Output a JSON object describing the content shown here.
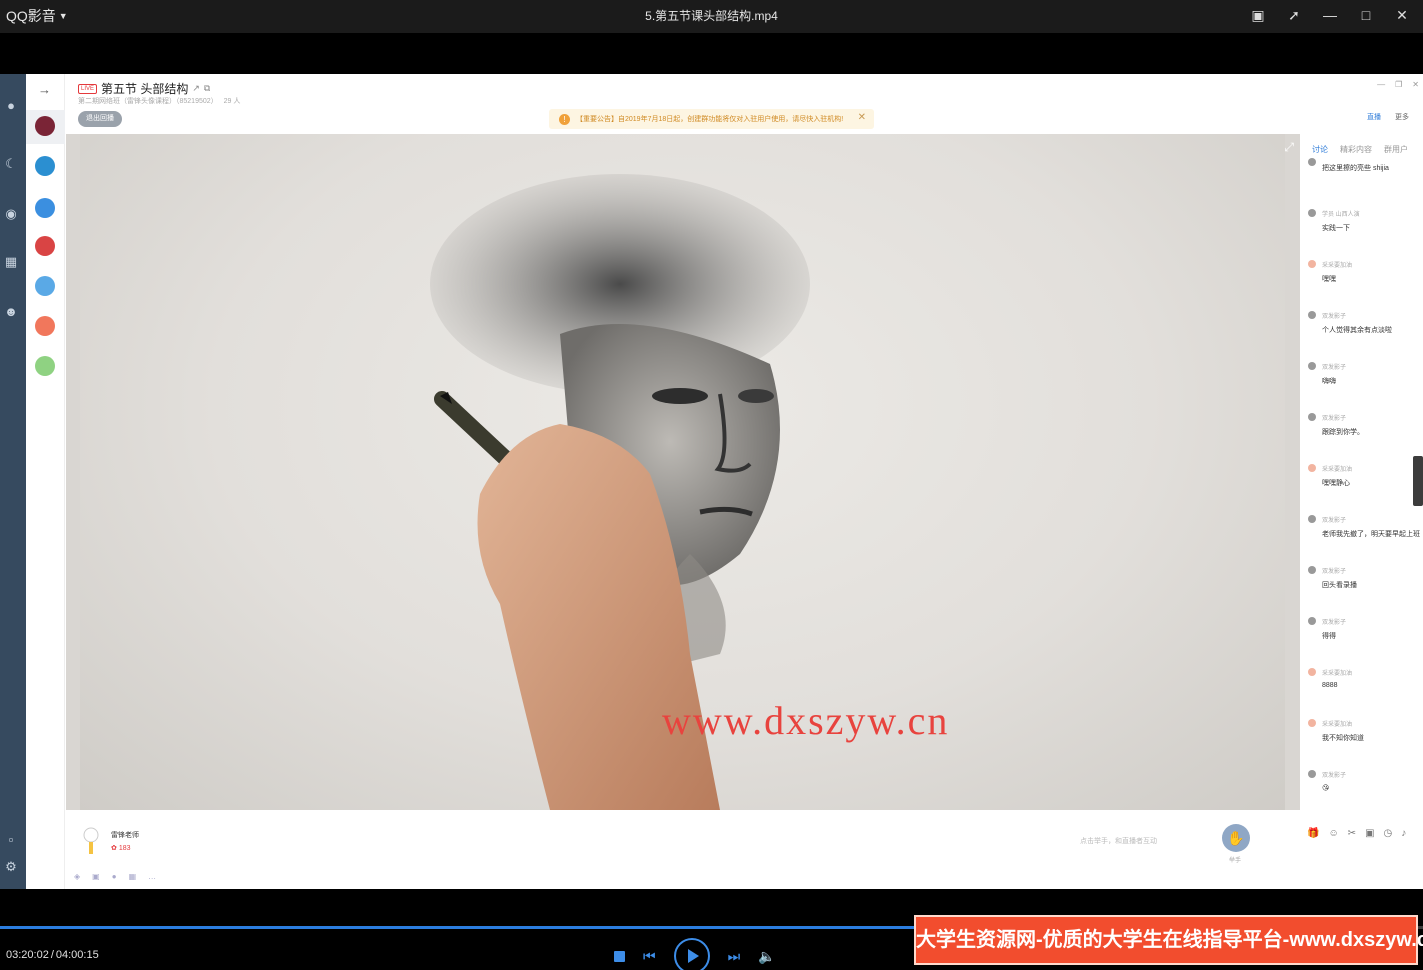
{
  "titlebar": {
    "app_name": "QQ影音",
    "file_title": "5.第五节课头部结构.mp4"
  },
  "classroom": {
    "title": "第五节 头部结构",
    "live_badge": "LIVE",
    "sub_info": "第二期网络班（雷锋头像课程）（85219502）",
    "viewer_count": "29 人",
    "exit_button": "退出回播",
    "notice": "【重要公告】自2019年7月18日起，创建群功能将仅对入驻用户使用，请尽快入驻机构!",
    "top_links": [
      "直播",
      "更多"
    ]
  },
  "video": {
    "watermark": "www.dxszyw.cn"
  },
  "chat": {
    "tabs": [
      "讨论",
      "精彩内容",
      "群用户"
    ],
    "messages": [
      {
        "name": "",
        "text": "把这里擦的亮些 shijia"
      },
      {
        "name": "学员 山西人演",
        "text": "实践一下"
      },
      {
        "name": "采采要加油",
        "text": "嘿嘿"
      },
      {
        "name": "双发影子",
        "text": "个人觉得其余有点淡啦"
      },
      {
        "name": "双发影子",
        "text": "嗨嗨"
      },
      {
        "name": "双发影子",
        "text": "跟踪到你学。"
      },
      {
        "name": "采采要加油",
        "text": "嘿嘿静心"
      },
      {
        "name": "双发影子",
        "text": "老师我先撤了，明天要早起上班"
      },
      {
        "name": "双发影子",
        "text": "回头看录播"
      },
      {
        "name": "双发影子",
        "text": "得得"
      },
      {
        "name": "采采要加油",
        "text": "8888"
      },
      {
        "name": "采采要加油",
        "text": "我不知你知道"
      },
      {
        "name": "双发影子",
        "text": "😘"
      }
    ]
  },
  "bottom": {
    "teacher_name": "雷锋老师",
    "flowers": "183",
    "handup_hint": "点击举手，和直播者互动",
    "handup_label": "举手"
  },
  "player": {
    "current_time": "03:20:02",
    "separator": "/",
    "total_time": "04:00:15",
    "progress_fraction": 0.833
  },
  "banner": {
    "text": "大学生资源网-优质的大学生在线指导平台-www.dxszyw.cn"
  }
}
